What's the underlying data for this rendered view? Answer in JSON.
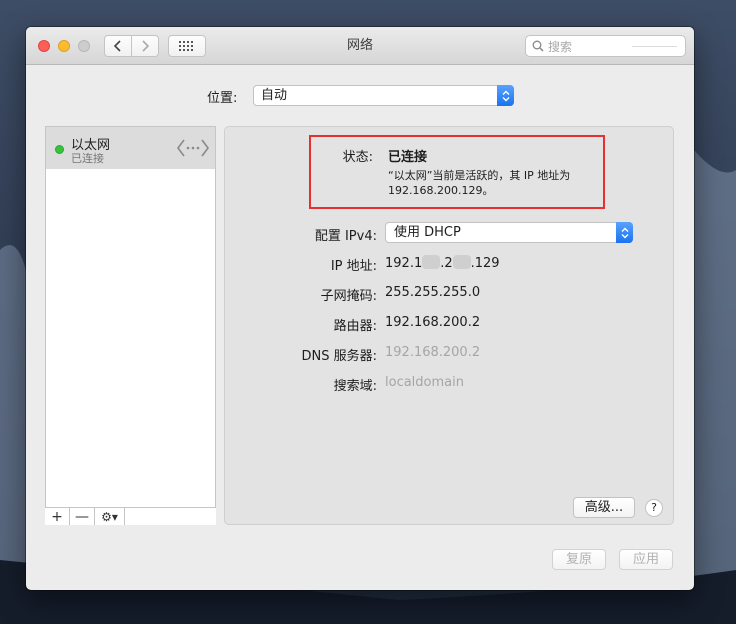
{
  "window": {
    "title": "网络"
  },
  "toolbar": {
    "search_placeholder": "搜索"
  },
  "location": {
    "label": "位置:",
    "value": "自动"
  },
  "sidebar": {
    "items": [
      {
        "name": "以太网",
        "status": "已连接",
        "status_color": "#35c33d",
        "icon": "ethernet-icon"
      }
    ],
    "add_label": "+",
    "remove_label": "—",
    "gear_label": "⚙▾"
  },
  "panel": {
    "status_label": "状态:",
    "status_value": "已连接",
    "status_desc_line1": "“以太网”当前是活跃的，其 IP 地址为",
    "status_desc_line2": "192.168.200.129。",
    "ipv4_label": "配置 IPv4:",
    "ipv4_value": "使用 DHCP",
    "ip_label": "IP 地址:",
    "ip_part1": "192.1",
    "ip_part2": ".2",
    "ip_part3": ".129",
    "subnet_label": "子网掩码:",
    "subnet_value": "255.255.255.0",
    "router_label": "路由器:",
    "router_value": "192.168.200.2",
    "dns_label": "DNS 服务器:",
    "dns_value": "192.168.200.2",
    "search_domain_label": "搜索域:",
    "search_domain_value": "localdomain",
    "advanced_label": "高级...",
    "help_label": "?"
  },
  "footer": {
    "revert_label": "复原",
    "apply_label": "应用"
  },
  "colors": {
    "highlight_box": "#e5302f",
    "accent": "#1a73f0"
  }
}
